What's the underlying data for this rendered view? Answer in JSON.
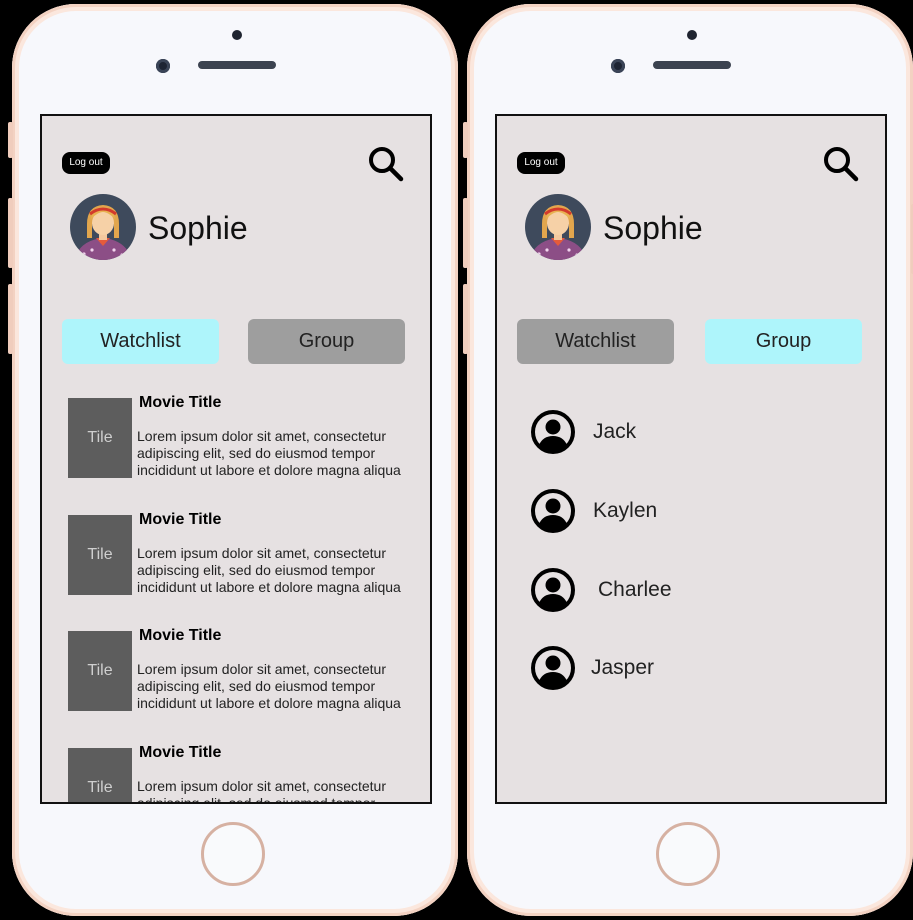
{
  "screens": [
    {
      "logout_label": "Log out",
      "username": "Sophie",
      "tabs": {
        "watchlist": "Watchlist",
        "group": "Group"
      },
      "active_tab": "watchlist",
      "movies": [
        {
          "tile": "Tile",
          "title": "Movie Title",
          "line1": "Lorem ipsum dolor sit amet, consectetur",
          "line2": "adipiscing elit, sed do eiusmod tempor",
          "line3": "incididunt ut labore et dolore magna aliqua"
        },
        {
          "tile": "Tile",
          "title": "Movie Title",
          "line1": "Lorem ipsum dolor sit amet, consectetur",
          "line2": "adipiscing elit, sed do eiusmod tempor",
          "line3": "incididunt ut labore et dolore magna aliqua"
        },
        {
          "tile": "Tile",
          "title": "Movie Title",
          "line1": "Lorem ipsum dolor sit amet, consectetur",
          "line2": "adipiscing elit, sed do eiusmod tempor",
          "line3": "incididunt ut labore et dolore magna aliqua"
        },
        {
          "tile": "Tile",
          "title": "Movie Title",
          "line1": "Lorem ipsum dolor sit amet, consectetur",
          "line2": "adipiscing elit, sed do eiusmod tempor",
          "line3": ""
        }
      ]
    },
    {
      "logout_label": "Log out",
      "username": "Sophie",
      "tabs": {
        "watchlist": "Watchlist",
        "group": "Group"
      },
      "active_tab": "group",
      "members": [
        {
          "name": "Jack"
        },
        {
          "name": "Kaylen"
        },
        {
          "name": "Charlee"
        },
        {
          "name": "Jasper"
        }
      ]
    }
  ],
  "icons": {
    "search": "search-icon",
    "avatar": "avatar",
    "member": "user-circle-icon"
  },
  "colors": {
    "active_tab": "#aef5fb",
    "inactive_tab": "#9e9e9e",
    "screen_bg": "#e6e1e2",
    "tile_bg": "#5d5d5d"
  }
}
